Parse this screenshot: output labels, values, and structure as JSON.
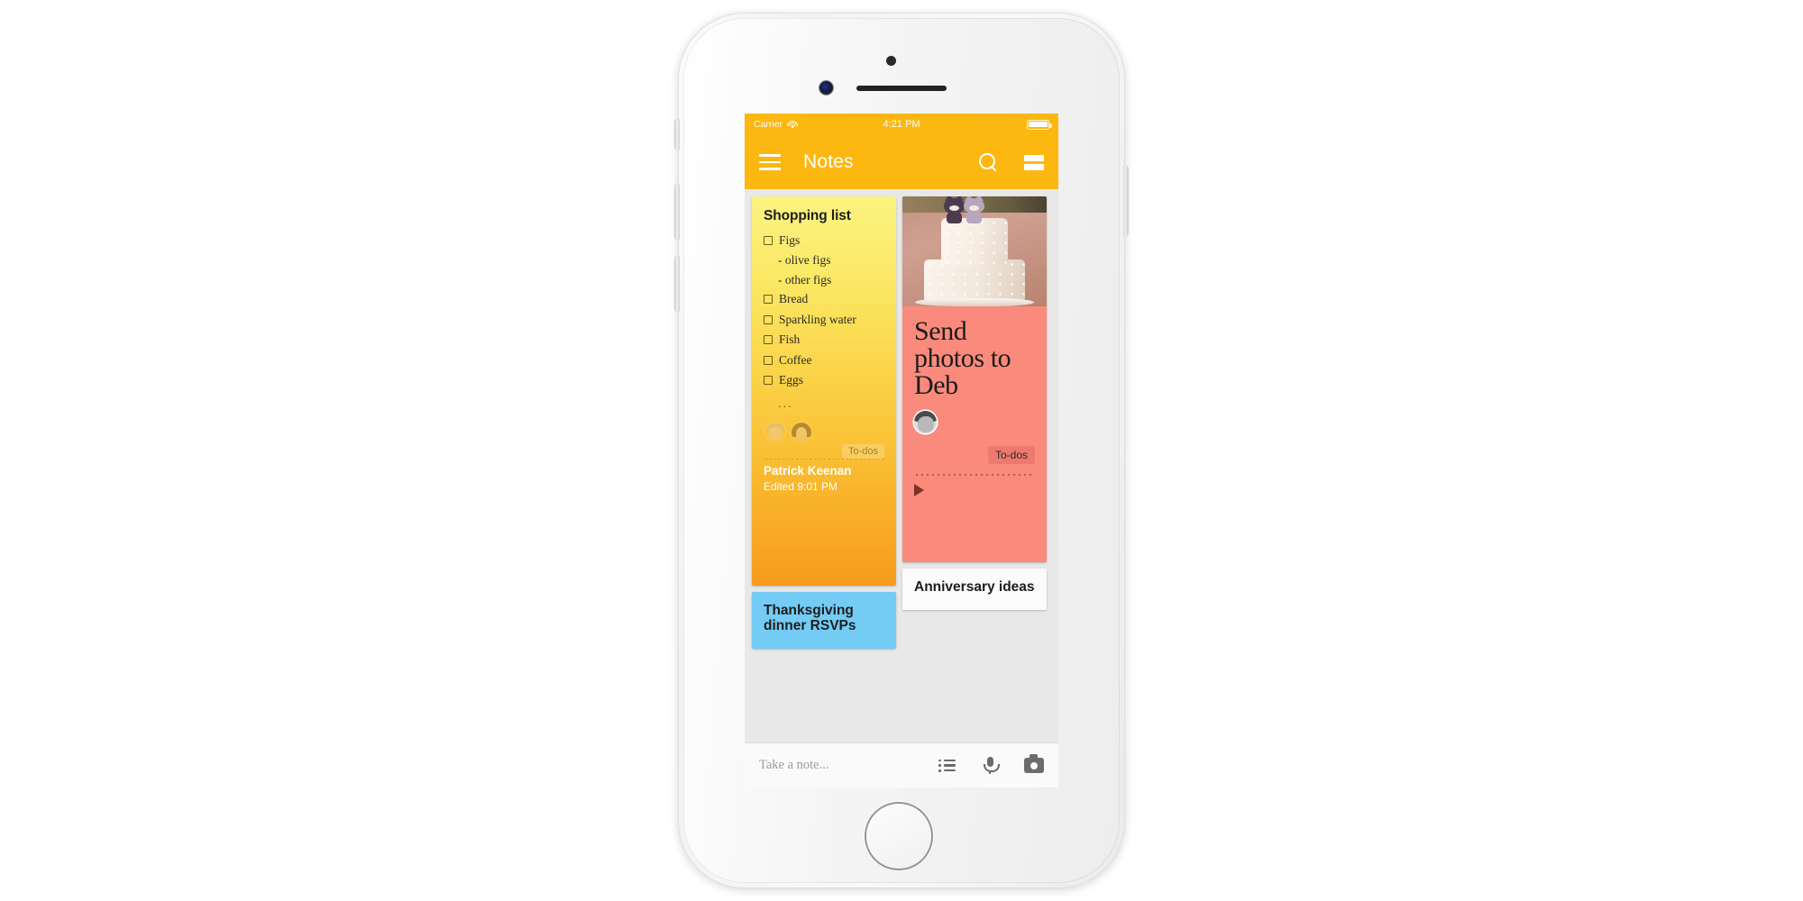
{
  "status_bar": {
    "carrier": "Carrier",
    "time": "4:21 PM",
    "wifi_icon": "wifi-icon",
    "battery_icon": "battery-full-icon"
  },
  "app_bar": {
    "menu_icon": "hamburger-menu-icon",
    "title": "Notes",
    "search_icon": "search-icon",
    "view_toggle_icon": "list-view-toggle-icon"
  },
  "notes": {
    "shopping": {
      "title": "Shopping list",
      "items": [
        {
          "type": "checkbox",
          "text": "Figs"
        },
        {
          "type": "sub",
          "text": "- olive figs"
        },
        {
          "type": "sub",
          "text": "- other figs"
        },
        {
          "type": "checkbox",
          "text": "Bread"
        },
        {
          "type": "checkbox",
          "text": "Sparkling water"
        },
        {
          "type": "checkbox",
          "text": "Fish"
        },
        {
          "type": "checkbox",
          "text": "Coffee"
        },
        {
          "type": "checkbox",
          "text": "Eggs"
        }
      ],
      "more": "...",
      "label_chip": "To-dos",
      "owner": "Patrick Keenan",
      "edited": "Edited 9:01 PM",
      "color_top": "#FBF382",
      "color_bottom": "#F79B1E",
      "collaborator_count": 2
    },
    "photos": {
      "title": "Send photos to Deb",
      "label_chip": "To-dos",
      "play_icon": "play-icon",
      "image_alt": "wedding-cake-photo",
      "color": "#FA8A7B",
      "collaborator_count": 1
    },
    "thanksgiving": {
      "title": "Thanksgiving dinner RSVPs",
      "color": "#74CBF4"
    },
    "anniversary": {
      "title": "Anniversary ideas",
      "color": "#FBFBFB"
    }
  },
  "take_note_bar": {
    "placeholder": "Take a note...",
    "list_icon": "new-list-icon",
    "mic_icon": "microphone-icon",
    "camera_icon": "camera-icon"
  },
  "theme": {
    "accent": "#FCB711",
    "screen_bg": "#E8E8E8"
  }
}
